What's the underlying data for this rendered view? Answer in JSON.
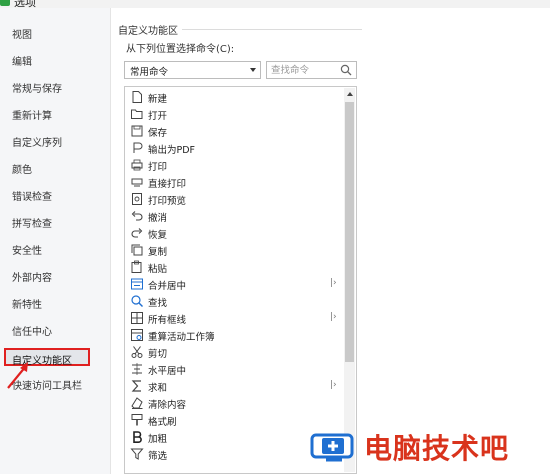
{
  "window": {
    "title": "选项"
  },
  "sidebar": {
    "items": [
      {
        "label": "视图"
      },
      {
        "label": "编辑"
      },
      {
        "label": "常规与保存"
      },
      {
        "label": "重新计算"
      },
      {
        "label": "自定义序列"
      },
      {
        "label": "颜色"
      },
      {
        "label": "错误检查"
      },
      {
        "label": "拼写检查"
      },
      {
        "label": "安全性"
      },
      {
        "label": "外部内容"
      },
      {
        "label": "新特性"
      },
      {
        "label": "信任中心"
      },
      {
        "label": "自定义功能区"
      },
      {
        "label": "快速访问工具栏"
      }
    ],
    "selected_index": 12
  },
  "main": {
    "group_title": "自定义功能区",
    "from_label": "从下列位置选择命令(C):",
    "select_value": "常用命令",
    "search_placeholder": "查找命令",
    "commands": [
      {
        "label": "新建",
        "icon": "new-doc-icon"
      },
      {
        "label": "打开",
        "icon": "folder-open-icon"
      },
      {
        "label": "保存",
        "icon": "save-icon"
      },
      {
        "label": "输出为PDF",
        "icon": "pdf-export-icon"
      },
      {
        "label": "打印",
        "icon": "print-icon"
      },
      {
        "label": "直接打印",
        "icon": "direct-print-icon"
      },
      {
        "label": "打印预览",
        "icon": "print-preview-icon"
      },
      {
        "label": "撤消",
        "icon": "undo-icon"
      },
      {
        "label": "恢复",
        "icon": "redo-icon"
      },
      {
        "label": "复制",
        "icon": "copy-icon"
      },
      {
        "label": "粘贴",
        "icon": "paste-icon"
      },
      {
        "label": "合并居中",
        "icon": "merge-center-icon",
        "more": "|›"
      },
      {
        "label": "查找",
        "icon": "find-icon"
      },
      {
        "label": "所有框线",
        "icon": "all-borders-icon",
        "more": "|›"
      },
      {
        "label": "重算活动工作簿",
        "icon": "recalc-icon"
      },
      {
        "label": "剪切",
        "icon": "cut-icon"
      },
      {
        "label": "水平居中",
        "icon": "align-center-icon"
      },
      {
        "label": "求和",
        "icon": "sum-icon",
        "more": "|›"
      },
      {
        "label": "清除内容",
        "icon": "eraser-icon"
      },
      {
        "label": "格式刷",
        "icon": "format-painter-icon"
      },
      {
        "label": "加粗",
        "icon": "bold-icon"
      },
      {
        "label": "筛选",
        "icon": "filter-icon"
      }
    ]
  },
  "watermark": {
    "text": "电脑技术吧"
  },
  "colors": {
    "highlight_border": "#e02020",
    "watermark": "#d9331c",
    "watermark_icon": "#1f6fd1"
  }
}
